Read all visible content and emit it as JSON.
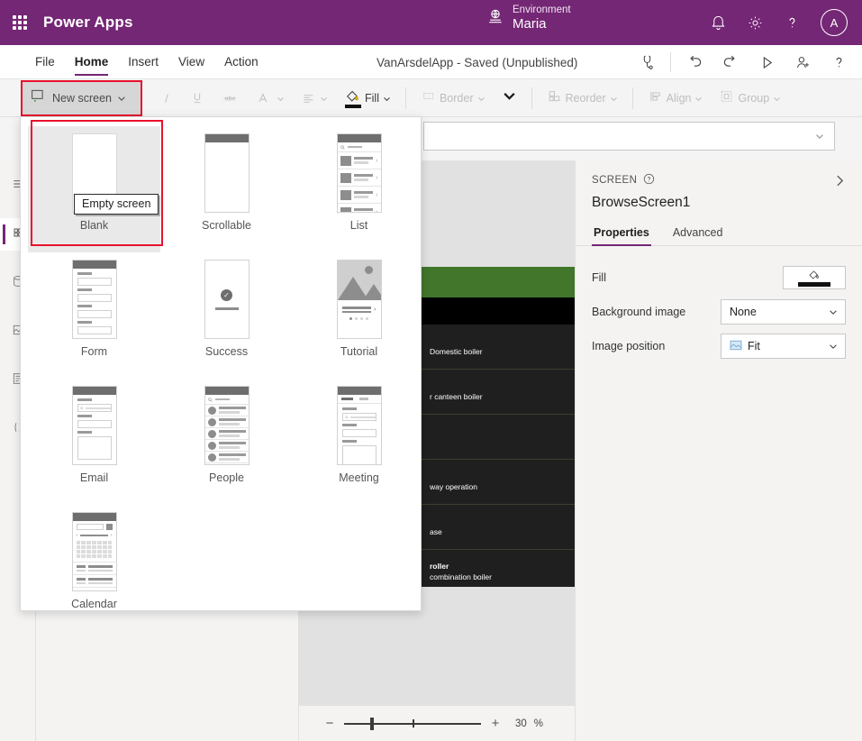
{
  "header": {
    "waffle_icon": "app-launcher-icon",
    "brand": "Power Apps",
    "environment_label": "Environment",
    "environment_name": "Maria",
    "environment_icon": "environment-globe-icon",
    "notification_icon": "bell-icon",
    "settings_icon": "gear-icon",
    "help_icon": "question-icon",
    "avatar_initial": "A",
    "purple": "#742774"
  },
  "menubar": {
    "items": [
      {
        "label": "File",
        "active": false
      },
      {
        "label": "Home",
        "active": true
      },
      {
        "label": "Insert",
        "active": false
      },
      {
        "label": "View",
        "active": false
      },
      {
        "label": "Action",
        "active": false
      }
    ],
    "app_title": "VanArsdelApp - Saved (Unpublished)",
    "right_icons": [
      "app-checker-icon",
      "undo-icon",
      "redo-icon",
      "preview-play-icon",
      "share-person-icon",
      "help-question-icon"
    ]
  },
  "ribbon": {
    "new_screen_label": "New screen",
    "new_screen_icon": "new-screen-icon",
    "highlight_color": "#e8112d",
    "tools": [
      {
        "name": "italic",
        "label": "",
        "icon": "italic-icon",
        "enabled": false
      },
      {
        "name": "underline",
        "label": "",
        "icon": "underline-icon",
        "enabled": false
      },
      {
        "name": "strikethrough",
        "label": "",
        "icon": "strikethrough-icon",
        "enabled": false
      },
      {
        "name": "font-color",
        "label": "",
        "icon": "font-color-icon",
        "enabled": false
      },
      {
        "name": "align",
        "label": "",
        "icon": "align-left-icon",
        "enabled": false
      },
      {
        "name": "fill",
        "label": "Fill",
        "icon": "fill-bucket-icon",
        "enabled": true
      },
      {
        "name": "border",
        "label": "Border",
        "icon": "border-icon",
        "enabled": false
      },
      {
        "name": "more",
        "label": "",
        "icon": "chevron-down-icon",
        "enabled": true
      },
      {
        "name": "reorder",
        "label": "Reorder",
        "icon": "reorder-icon",
        "enabled": false
      },
      {
        "name": "align-group",
        "label": "Align",
        "icon": "align-objects-icon",
        "enabled": false
      },
      {
        "name": "group",
        "label": "Group",
        "icon": "group-icon",
        "enabled": false
      }
    ]
  },
  "formula_bar": {
    "value": "",
    "placeholder": ""
  },
  "left_rail": {
    "items": [
      {
        "name": "tree-view",
        "icon": "tree-view-icon",
        "active": false
      },
      {
        "name": "insert",
        "icon": "insert-plus-icon",
        "active": true
      },
      {
        "name": "data",
        "icon": "data-icon",
        "active": false
      },
      {
        "name": "media",
        "icon": "media-icon",
        "active": false
      },
      {
        "name": "advanced",
        "icon": "advanced-icon",
        "active": false
      },
      {
        "name": "variables",
        "icon": "variables-icon",
        "active": false
      }
    ]
  },
  "flyout": {
    "templates": [
      {
        "label": "Blank",
        "thumb": "blank",
        "selected": true
      },
      {
        "label": "Scrollable",
        "thumb": "scrollable",
        "selected": false
      },
      {
        "label": "List",
        "thumb": "list",
        "selected": false
      },
      {
        "label": "Form",
        "thumb": "form",
        "selected": false
      },
      {
        "label": "Success",
        "thumb": "success",
        "selected": false
      },
      {
        "label": "Tutorial",
        "thumb": "tutorial",
        "selected": false
      },
      {
        "label": "Email",
        "thumb": "email",
        "selected": false
      },
      {
        "label": "People",
        "thumb": "people",
        "selected": false
      },
      {
        "label": "Meeting",
        "thumb": "meeting",
        "selected": false
      },
      {
        "label": "Calendar",
        "thumb": "calendar",
        "selected": false
      }
    ],
    "tooltip": "Empty screen"
  },
  "canvas": {
    "app_header_color": "#41762b",
    "refresh_icon": "refresh-icon",
    "sort_icon": "sort-icon",
    "chevron_color": "#8ab84f",
    "rows": [
      {
        "title": "",
        "subtitle": "Domestic boiler"
      },
      {
        "title": "",
        "subtitle": "r canteen boiler"
      },
      {
        "title": "",
        "subtitle": ""
      },
      {
        "title": "",
        "subtitle": "way operation"
      },
      {
        "title": "",
        "subtitle": "ase"
      },
      {
        "title": "roller",
        "subtitle": "combination boiler"
      }
    ]
  },
  "zoombar": {
    "minus": "−",
    "plus": "+",
    "value": "30",
    "unit": "%"
  },
  "right_panel": {
    "kicker": "SCREEN",
    "help_icon": "question-circle-icon",
    "expand_icon": "chevron-right-icon",
    "screen_name": "BrowseScreen1",
    "tabs": [
      {
        "label": "Properties",
        "active": true
      },
      {
        "label": "Advanced",
        "active": false
      }
    ],
    "rows": [
      {
        "label": "Fill",
        "control": "color",
        "value": ""
      },
      {
        "label": "Background image",
        "control": "select",
        "value": "None"
      },
      {
        "label": "Image position",
        "control": "select-icon",
        "value": "Fit",
        "icon": "image-fit-icon"
      }
    ]
  }
}
